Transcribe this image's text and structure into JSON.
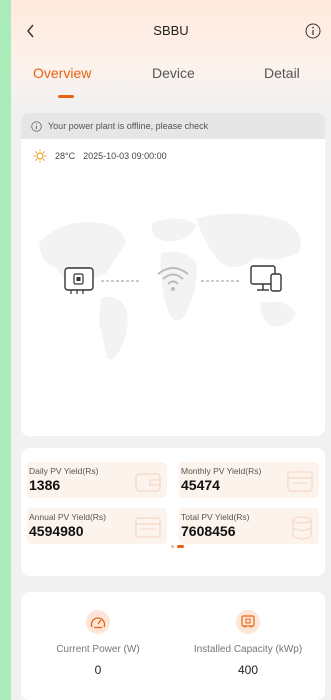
{
  "header": {
    "title": "SBBU"
  },
  "tabs": [
    {
      "label": "Overview",
      "active": true
    },
    {
      "label": "Device",
      "active": false
    },
    {
      "label": "Detail",
      "active": false
    }
  ],
  "banner": {
    "text": "Your power plant is offline, please check"
  },
  "weather": {
    "temperature": "28°C",
    "datetime": "2025-10-03 09:00:00",
    "icon": "sun-icon"
  },
  "yield": {
    "daily": {
      "label": "Daily PV Yield(Rs)",
      "value": "1386"
    },
    "monthly": {
      "label": "Monthly PV Yield(Rs)",
      "value": "45474"
    },
    "annual": {
      "label": "Annual PV Yield(Rs)",
      "value": "4594980"
    },
    "total": {
      "label": "Total PV Yield(Rs)",
      "value": "7608456"
    }
  },
  "metrics": {
    "current_power": {
      "label": "Current Power (W)",
      "value": "0"
    },
    "installed_capacity": {
      "label": "Installed Capacity (kWp)",
      "value": "400"
    }
  },
  "colors": {
    "accent": "#e8620f",
    "page_background": "#a9ebb9"
  }
}
